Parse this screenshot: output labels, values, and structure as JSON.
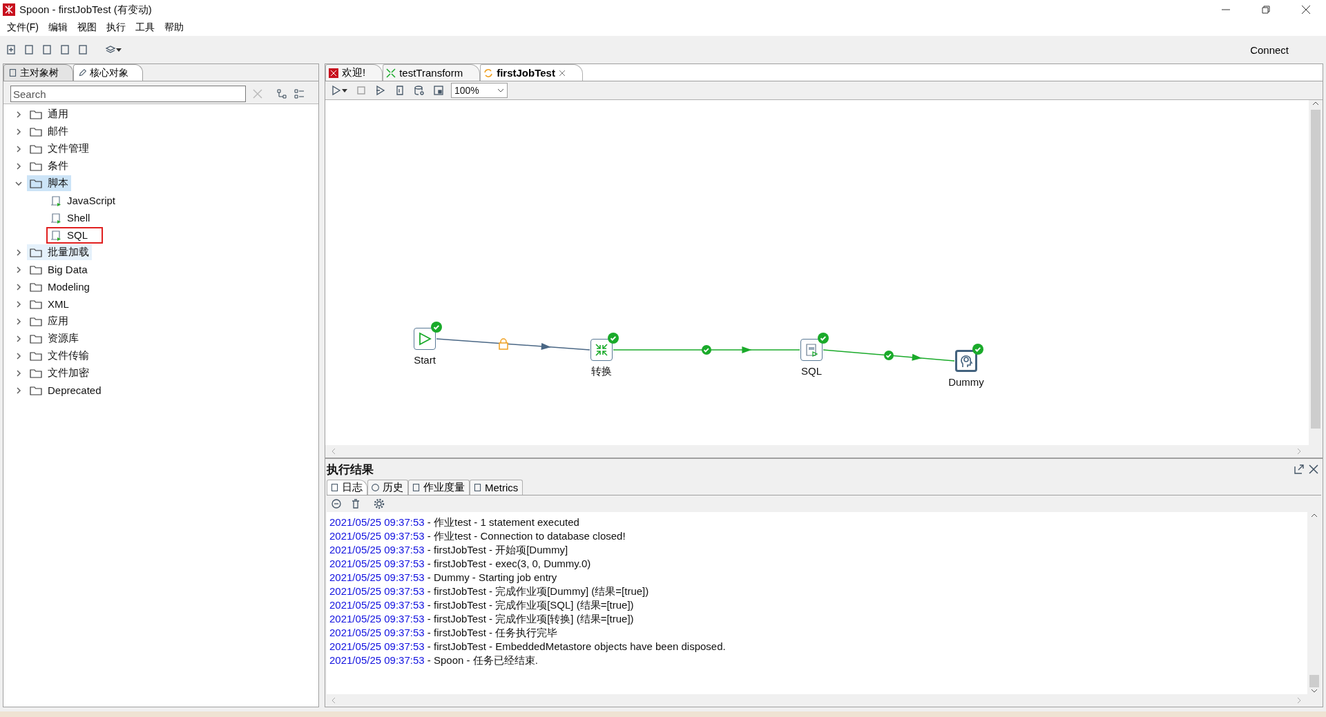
{
  "window": {
    "title": "Spoon - firstJobTest (有变动)"
  },
  "menu": [
    "文件(F)",
    "编辑",
    "视图",
    "执行",
    "工具",
    "帮助"
  ],
  "toolbar": {
    "connect": "Connect"
  },
  "left_tabs": [
    {
      "label": "主对象树",
      "selected": false
    },
    {
      "label": "核心对象",
      "selected": true
    }
  ],
  "search": {
    "placeholder": "Search"
  },
  "tree": [
    {
      "label": "通用",
      "expanded": false,
      "selected": false
    },
    {
      "label": "邮件",
      "expanded": false,
      "selected": false
    },
    {
      "label": "文件管理",
      "expanded": false,
      "selected": false
    },
    {
      "label": "条件",
      "expanded": false,
      "selected": false
    },
    {
      "label": "脚本",
      "expanded": true,
      "selected": true,
      "children": [
        {
          "label": "JavaScript",
          "outlined": false
        },
        {
          "label": "Shell",
          "outlined": false
        },
        {
          "label": "SQL",
          "outlined": true
        }
      ]
    },
    {
      "label": "批量加载",
      "expanded": false,
      "selected": false,
      "hovered": true
    },
    {
      "label": "Big Data",
      "expanded": false,
      "selected": false
    },
    {
      "label": "Modeling",
      "expanded": false,
      "selected": false
    },
    {
      "label": "XML",
      "expanded": false,
      "selected": false
    },
    {
      "label": "应用",
      "expanded": false,
      "selected": false
    },
    {
      "label": "资源库",
      "expanded": false,
      "selected": false
    },
    {
      "label": "文件传输",
      "expanded": false,
      "selected": false
    },
    {
      "label": "文件加密",
      "expanded": false,
      "selected": false
    },
    {
      "label": "Deprecated",
      "expanded": false,
      "selected": false
    }
  ],
  "editor_tabs": [
    {
      "label": "欢迎!",
      "kind": "welcome",
      "selected": false
    },
    {
      "label": "testTransform",
      "kind": "transform",
      "selected": false
    },
    {
      "label": "firstJobTest",
      "kind": "job",
      "selected": true
    }
  ],
  "zoom": {
    "value": "100%"
  },
  "nodes": [
    {
      "label": "Start",
      "kind": "start",
      "success": true
    },
    {
      "label": "转换",
      "kind": "transform",
      "success": true
    },
    {
      "label": "SQL",
      "kind": "sql",
      "success": true
    },
    {
      "label": "Dummy",
      "kind": "dummy",
      "success": true
    }
  ],
  "hops": [
    {
      "kind": "locked"
    },
    {
      "kind": "success"
    },
    {
      "kind": "success"
    }
  ],
  "results": {
    "title": "执行结果",
    "tabs": [
      {
        "label": "日志",
        "selected": true
      },
      {
        "label": "历史",
        "selected": false
      },
      {
        "label": "作业度量",
        "selected": false
      },
      {
        "label": "Metrics",
        "selected": false
      }
    ],
    "log": [
      {
        "time": "2021/05/25 09:37:53",
        "text": " - 作业test - 1 statement executed"
      },
      {
        "time": "2021/05/25 09:37:53",
        "text": " - 作业test - Connection to database closed!"
      },
      {
        "time": "2021/05/25 09:37:53",
        "text": " - firstJobTest - 开始项[Dummy]"
      },
      {
        "time": "2021/05/25 09:37:53",
        "text": " - firstJobTest - exec(3, 0, Dummy.0)"
      },
      {
        "time": "2021/05/25 09:37:53",
        "text": " - Dummy - Starting job entry"
      },
      {
        "time": "2021/05/25 09:37:53",
        "text": " - firstJobTest - 完成作业项[Dummy] (结果=[true])"
      },
      {
        "time": "2021/05/25 09:37:53",
        "text": " - firstJobTest - 完成作业项[SQL] (结果=[true])"
      },
      {
        "time": "2021/05/25 09:37:53",
        "text": " - firstJobTest - 完成作业项[转换] (结果=[true])"
      },
      {
        "time": "2021/05/25 09:37:53",
        "text": " - firstJobTest - 任务执行完毕"
      },
      {
        "time": "2021/05/25 09:37:53",
        "text": " - firstJobTest - EmbeddedMetastore objects have been disposed."
      },
      {
        "time": "2021/05/25 09:37:53",
        "text": " - Spoon - 任务已经结束."
      }
    ]
  }
}
